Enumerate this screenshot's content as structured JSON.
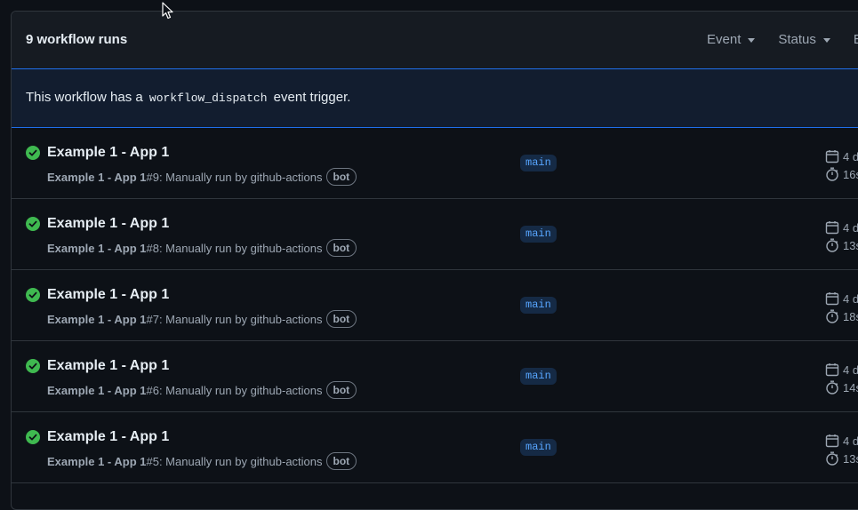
{
  "header": {
    "runs_count": "9 workflow runs",
    "filters": [
      "Event",
      "Status",
      "B"
    ]
  },
  "notice": {
    "prefix": "This workflow has a ",
    "code": "workflow_dispatch",
    "suffix": " event trigger."
  },
  "colors": {
    "success": "#3fb950",
    "accent": "#1f6feb",
    "branch_text": "#58a6ff"
  },
  "runs": [
    {
      "title": "Example 1 - App 1",
      "meta_bold": "Example 1 - App 1",
      "meta_rest": " #9: Manually run by github-actions",
      "bot": "bot",
      "branch": "main",
      "date": "4 d",
      "duration": "16s",
      "status_icon": "check-circle-icon"
    },
    {
      "title": "Example 1 - App 1",
      "meta_bold": "Example 1 - App 1",
      "meta_rest": " #8: Manually run by github-actions",
      "bot": "bot",
      "branch": "main",
      "date": "4 d",
      "duration": "13s",
      "status_icon": "check-circle-icon"
    },
    {
      "title": "Example 1 - App 1",
      "meta_bold": "Example 1 - App 1",
      "meta_rest": " #7: Manually run by github-actions",
      "bot": "bot",
      "branch": "main",
      "date": "4 d",
      "duration": "18s",
      "status_icon": "check-circle-icon"
    },
    {
      "title": "Example 1 - App 1",
      "meta_bold": "Example 1 - App 1",
      "meta_rest": " #6: Manually run by github-actions",
      "bot": "bot",
      "branch": "main",
      "date": "4 d",
      "duration": "14s",
      "status_icon": "check-circle-icon"
    },
    {
      "title": "Example 1 - App 1",
      "meta_bold": "Example 1 - App 1",
      "meta_rest": " #5: Manually run by github-actions",
      "bot": "bot",
      "branch": "main",
      "date": "4 d",
      "duration": "13s",
      "status_icon": "check-circle-icon"
    }
  ]
}
